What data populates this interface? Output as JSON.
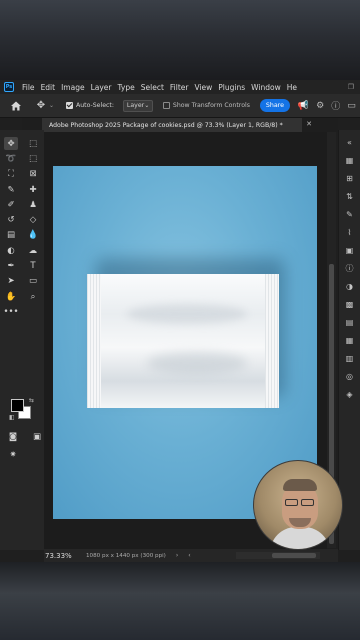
{
  "menubar": {
    "logo": "Ps",
    "items": [
      "File",
      "Edit",
      "Image",
      "Layer",
      "Type",
      "Select",
      "Filter",
      "View",
      "Plugins",
      "Window",
      "He"
    ]
  },
  "options": {
    "auto_select_label": "Auto-Select:",
    "auto_select_checked": true,
    "auto_select_target": "Layer",
    "show_transform_label": "Show Transform Controls",
    "show_transform_checked": false,
    "share_label": "Share"
  },
  "document": {
    "tab_title": "Adobe Photoshop 2025 Package of cookies.psd @ 73.3% (Layer 1, RGB/8) *"
  },
  "status": {
    "zoom": "73.33%",
    "doc_info": "1080 px x 1440 px (300 ppi)"
  },
  "colors": {
    "accent": "#1473e6",
    "canvas_background": "#6fb3d6",
    "foreground_swatch": "#000000",
    "background_swatch": "#ffffff"
  },
  "toolbar_icons": [
    [
      "move-icon",
      "artboard-icon"
    ],
    [
      "lasso-icon",
      "object-select-icon"
    ],
    [
      "crop-icon",
      "frame-icon"
    ],
    [
      "eyedropper-icon",
      "healing-brush-icon"
    ],
    [
      "brush-icon",
      "clone-stamp-icon"
    ],
    [
      "history-brush-icon",
      "eraser-icon"
    ],
    [
      "gradient-icon",
      "blur-icon"
    ],
    [
      "dodge-icon",
      "smudge-icon"
    ],
    [
      "pen-icon",
      "type-icon"
    ],
    [
      "path-select-icon",
      "rectangle-icon"
    ],
    [
      "hand-icon",
      "zoom-icon"
    ],
    [
      "more-tools-icon"
    ]
  ]
}
